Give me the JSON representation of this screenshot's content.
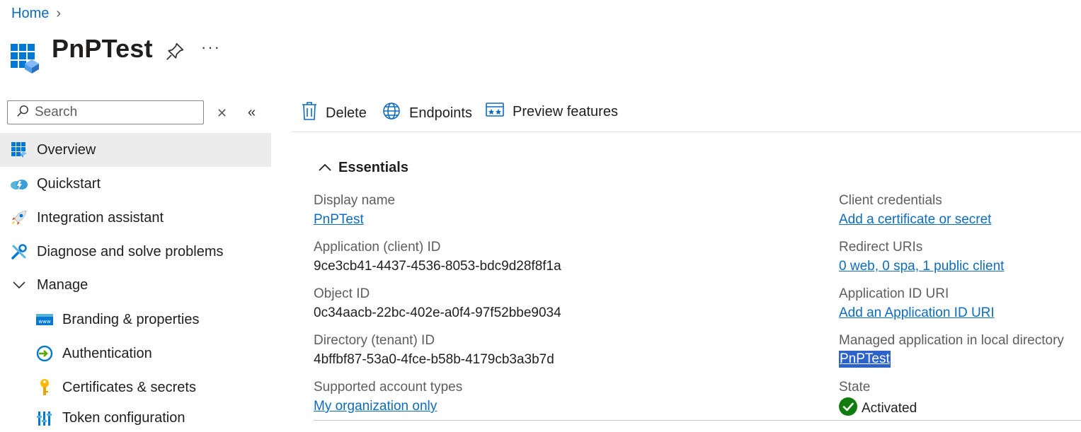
{
  "breadcrumb": {
    "home": "Home"
  },
  "header": {
    "title": "PnPTest",
    "more_label": "···"
  },
  "search": {
    "placeholder": "Search"
  },
  "nav": {
    "items": [
      {
        "label": "Overview"
      },
      {
        "label": "Quickstart"
      },
      {
        "label": "Integration assistant"
      },
      {
        "label": "Diagnose and solve problems"
      },
      {
        "label": "Manage"
      },
      {
        "label": "Branding & properties"
      },
      {
        "label": "Authentication"
      },
      {
        "label": "Certificates & secrets"
      },
      {
        "label": "Token configuration"
      }
    ]
  },
  "toolbar": {
    "delete": "Delete",
    "endpoints": "Endpoints",
    "preview": "Preview features"
  },
  "essentials": {
    "title": "Essentials",
    "left": [
      {
        "label": "Display name",
        "value": "PnPTest"
      },
      {
        "label": "Application (client) ID",
        "value": "9ce3cb41-4437-4536-8053-bdc9d28f8f1a"
      },
      {
        "label": "Object ID",
        "value": "0c34aacb-22bc-402e-a0f4-97f52bbe9034"
      },
      {
        "label": "Directory (tenant) ID",
        "value": "4bffbf87-53a0-4fce-b58b-4179cb3a3b7d"
      },
      {
        "label": "Supported account types",
        "value": "My organization only"
      }
    ],
    "right": [
      {
        "label": "Client credentials",
        "value": "Add a certificate or secret"
      },
      {
        "label": "Redirect URIs",
        "value": "0 web, 0 spa, 1 public client"
      },
      {
        "label": "Application ID URI",
        "value": "Add an Application ID URI"
      },
      {
        "label": "Managed application in local directory",
        "value": "PnPTest"
      },
      {
        "label": "State",
        "value": "Activated"
      }
    ]
  },
  "colors": {
    "accent": "#0f6cbd",
    "selected_bg": "#ececec",
    "success": "#107c10",
    "highlight": "#2d62c8"
  }
}
